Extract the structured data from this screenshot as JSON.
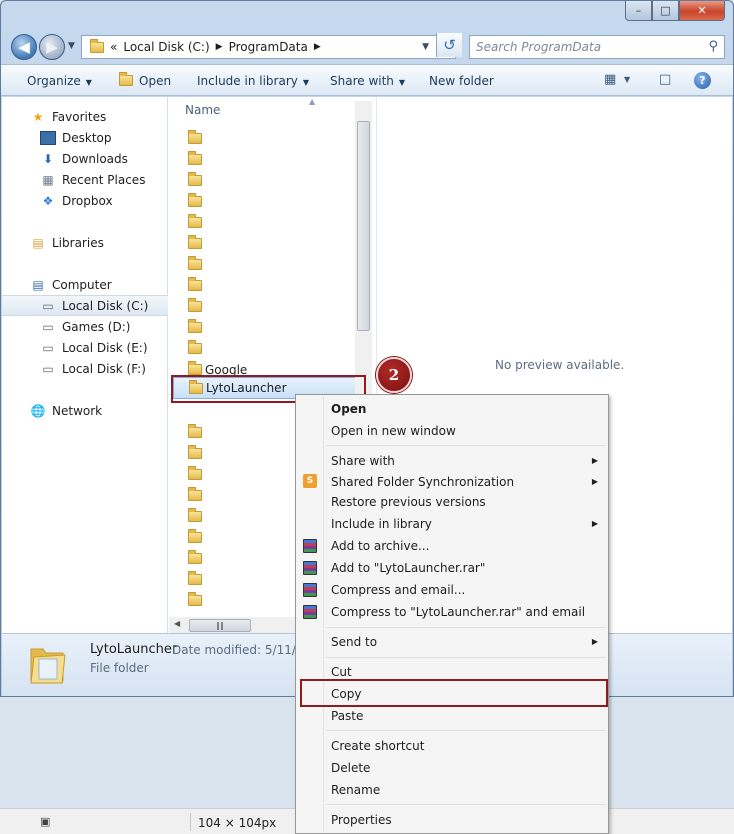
{
  "window": {
    "caption": {
      "minimize": "–",
      "maximize": "□",
      "close": "✕"
    }
  },
  "address": {
    "overflow": "«",
    "crumbs": [
      "Local Disk (C:)",
      "ProgramData"
    ],
    "search_placeholder": "Search ProgramData"
  },
  "toolbar": {
    "organize": "Organize",
    "open": "Open",
    "include": "Include in library",
    "share": "Share with",
    "new_folder": "New folder"
  },
  "nav": {
    "favorites": "Favorites",
    "desktop": "Desktop",
    "downloads": "Downloads",
    "recent": "Recent Places",
    "dropbox": "Dropbox",
    "libraries": "Libraries",
    "computer": "Computer",
    "local_c": "Local Disk (C:)",
    "games_d": "Games (D:)",
    "local_e": "Local Disk (E:)",
    "local_f": "Local Disk (F:)",
    "network": "Network"
  },
  "files": {
    "column_name": "Name",
    "google": "Google",
    "selected": "LytoLauncher"
  },
  "preview": {
    "text": "No preview available."
  },
  "details": {
    "name": "LytoLauncher",
    "modified": "Date modified: 5/11/20",
    "type": "File folder"
  },
  "annotation": {
    "step": "2"
  },
  "context_menu": {
    "open": "Open",
    "open_new_window": "Open in new window",
    "share_with": "Share with",
    "shared_sync": "Shared Folder Synchronization",
    "restore": "Restore previous versions",
    "include": "Include in library",
    "add_archive": "Add to archive...",
    "add_rar": "Add to \"LytoLauncher.rar\"",
    "compress_email": "Compress and email...",
    "compress_rar_email": "Compress to \"LytoLauncher.rar\" and email",
    "send_to": "Send to",
    "cut": "Cut",
    "copy": "Copy",
    "paste": "Paste",
    "create_shortcut": "Create shortcut",
    "delete": "Delete",
    "rename": "Rename",
    "properties": "Properties"
  },
  "statusbar": {
    "size": "104 × 104px"
  },
  "colors": {
    "highlight": "#8e1c1c",
    "selection": "#c8e0f9"
  }
}
